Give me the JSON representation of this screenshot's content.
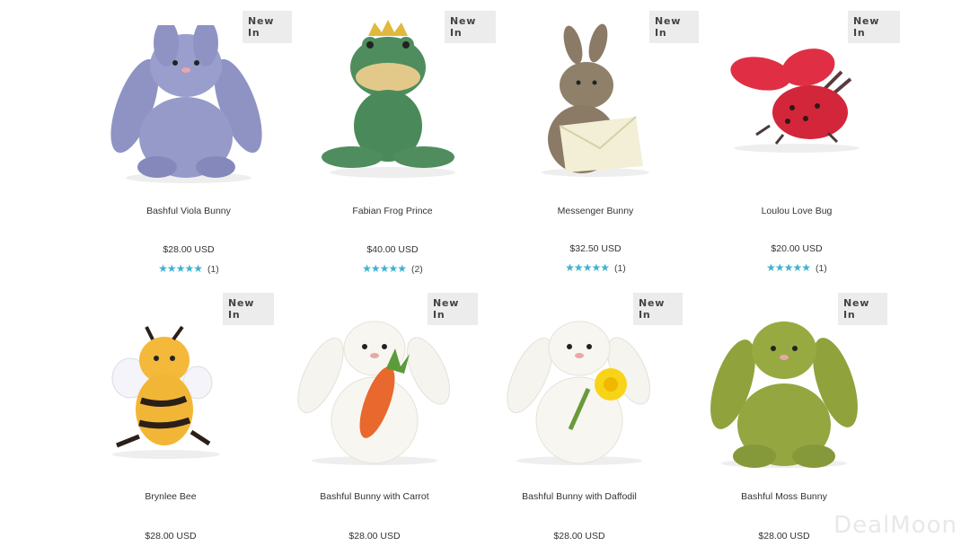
{
  "badge": "New In",
  "products": [
    {
      "name": "Bashful Viola Bunny",
      "price": "$28.00 USD",
      "stars": "★★★★★",
      "reviews": "(1)",
      "color": "#8f93c3",
      "kind": "bunny"
    },
    {
      "name": "Fabian Frog Prince",
      "price": "$40.00 USD",
      "stars": "★★★★★",
      "reviews": "(2)",
      "color": "#4f8d5e",
      "kind": "frog"
    },
    {
      "name": "Messenger Bunny",
      "price": "$32.50 USD",
      "stars": "★★★★★",
      "reviews": "(1)",
      "color": "#8a7a66",
      "kind": "bunny-letter"
    },
    {
      "name": "Loulou Love Bug",
      "price": "$20.00 USD",
      "stars": "★★★★★",
      "reviews": "(1)",
      "color": "#d3263b",
      "kind": "ladybug"
    },
    {
      "name": "Brynlee Bee",
      "price": "$28.00 USD",
      "color": "#f2b636",
      "kind": "bee"
    },
    {
      "name": "Bashful Bunny with Carrot",
      "price": "$28.00 USD",
      "color": "#f5f3ee",
      "kind": "bunny-carrot"
    },
    {
      "name": "Bashful Bunny with Daffodil",
      "price": "$28.00 USD",
      "color": "#f5f3ee",
      "kind": "bunny-daffodil"
    },
    {
      "name": "Bashful Moss Bunny",
      "price": "$28.00 USD",
      "color": "#8fa23c",
      "kind": "bunny"
    }
  ],
  "watermark": "DealMoon"
}
